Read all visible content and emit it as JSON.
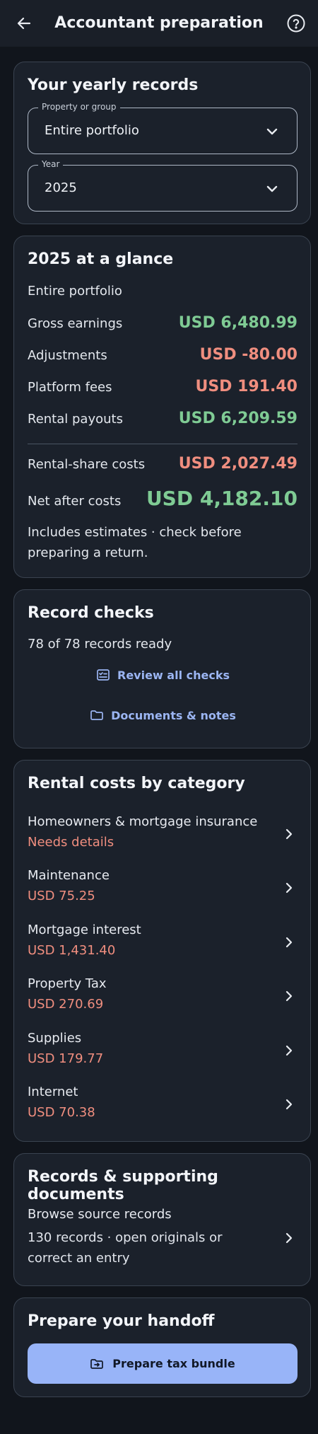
{
  "header": {
    "title": "Accountant preparation",
    "back_icon": "arrow-left-icon",
    "help_icon": "help-circle-icon"
  },
  "records_card": {
    "title": "Your yearly records",
    "property_field": {
      "label": "Property or group",
      "value": "Entire portfolio"
    },
    "year_field": {
      "label": "Year",
      "value": "2025"
    }
  },
  "glance": {
    "title": "2025 at a glance",
    "scope": "Entire portfolio",
    "rows": [
      {
        "label": "Gross earnings",
        "value": "USD 6,480.99",
        "tone": "pos"
      },
      {
        "label": "Adjustments",
        "value": "USD -80.00",
        "tone": "neg"
      },
      {
        "label": "Platform fees",
        "value": "USD 191.40",
        "tone": "neg"
      },
      {
        "label": "Rental payouts",
        "value": "USD 6,209.59",
        "tone": "pos"
      }
    ],
    "costs_label": "Rental-share costs",
    "costs_value": "USD 2,027.49",
    "net_label": "Net after costs",
    "net_value": "USD 4,182.10",
    "note": "Includes estimates · check before preparing a return."
  },
  "checks": {
    "title": "Record checks",
    "status": "78 of 78 records ready",
    "review_label": "Review all checks",
    "docs_label": "Documents & notes"
  },
  "categories": {
    "title": "Rental costs by category",
    "items": [
      {
        "name": "Homeowners & mortgage insurance",
        "amount": "Needs details"
      },
      {
        "name": "Maintenance",
        "amount": "USD 75.25"
      },
      {
        "name": "Mortgage interest",
        "amount": "USD 1,431.40"
      },
      {
        "name": "Property Tax",
        "amount": "USD 270.69"
      },
      {
        "name": "Supplies",
        "amount": "USD 179.77"
      },
      {
        "name": "Internet",
        "amount": "USD 70.38"
      }
    ]
  },
  "records": {
    "title": "Records & supporting documents",
    "item_name": "Browse source records",
    "item_desc": "130 records · open originals or correct an entry"
  },
  "handoff": {
    "title": "Prepare your handoff",
    "button_label": "Prepare tax bundle"
  },
  "colors": {
    "positive": "#7fcb94",
    "negative": "#f08e7f",
    "accent": "#98b4f8",
    "link": "#9bb5f2"
  }
}
